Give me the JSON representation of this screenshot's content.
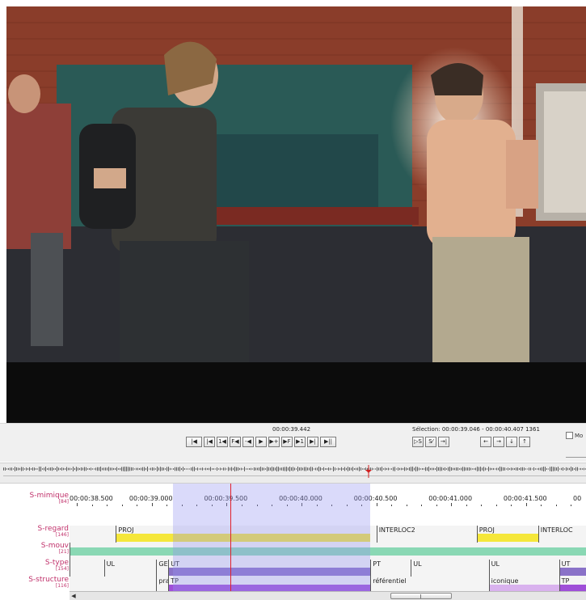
{
  "video": {
    "scene": "video-frame"
  },
  "transport": {
    "current_time": "00:00:39.442",
    "selection": "Sélection: 00:00:39.046 - 00:00:40.407  1361",
    "buttons": [
      {
        "label": "|◀",
        "name": "go-to-begin-button"
      },
      {
        "label": "|◀",
        "name": "previous-frame-button"
      },
      {
        "label": "1◀",
        "name": "step-back-1-button"
      },
      {
        "label": "F◀",
        "name": "fast-backward-button"
      },
      {
        "label": "-◀",
        "name": "step-back-ms-button"
      },
      {
        "label": "▶",
        "name": "play-button"
      },
      {
        "label": "▶+",
        "name": "step-forward-ms-button"
      },
      {
        "label": "▶F",
        "name": "fast-forward-button"
      },
      {
        "label": "▶1",
        "name": "step-forward-1-button"
      },
      {
        "label": "▶|",
        "name": "next-frame-button"
      },
      {
        "label": "▶||",
        "name": "go-to-end-button"
      }
    ],
    "selection_buttons": [
      {
        "label": "▷S",
        "name": "play-selection-button"
      },
      {
        "label": "S⁄",
        "name": "clear-selection-button"
      },
      {
        "label": "→|",
        "name": "selection-boundary-button"
      }
    ],
    "nav_buttons": [
      {
        "label": "←",
        "name": "navigate-left-button"
      },
      {
        "label": "→",
        "name": "navigate-right-button"
      },
      {
        "label": "↓",
        "name": "navigate-down-button"
      },
      {
        "label": "↑",
        "name": "navigate-up-button"
      }
    ],
    "checkbox_label": "Mo"
  },
  "ruler": {
    "labels": [
      "00:00:38.500",
      "00:00:39.000",
      "00:00:39.500",
      "00:00:40.000",
      "00:00:40.500",
      "00:00:41.000",
      "00:00:41.500",
      "00"
    ]
  },
  "tiers": [
    {
      "name": "S-mimique",
      "count": "[84]",
      "color": "#f4f4f4",
      "segments": []
    },
    {
      "name": "S-regard",
      "count": "[146]",
      "segments": [
        {
          "label": "PROJ",
          "start": 38.76,
          "end": 40.46,
          "color": "#f5e73a"
        },
        {
          "label": "INTERLOC2",
          "start": 40.5,
          "end": 41.17,
          "color": ""
        },
        {
          "label": "PROJ",
          "start": 41.17,
          "end": 41.58,
          "color": "#f5e73a"
        },
        {
          "label": "INTERLOC",
          "start": 41.58,
          "end": 41.9,
          "color": ""
        }
      ]
    },
    {
      "name": "S-mouv",
      "count": "[21]",
      "segments": [
        {
          "label": "",
          "start": 38.45,
          "end": 41.9,
          "color": "#8ad8b4"
        }
      ]
    },
    {
      "name": "S-type",
      "count": "[154]",
      "segments": [
        {
          "label": "",
          "start": 38.45,
          "end": 38.52,
          "color": ""
        },
        {
          "label": "UL",
          "start": 38.68,
          "end": 39.03,
          "color": ""
        },
        {
          "label": "GE",
          "start": 39.03,
          "end": 39.11,
          "color": ""
        },
        {
          "label": "UT",
          "start": 39.11,
          "end": 40.46,
          "color": "#8a72c8"
        },
        {
          "label": "PT",
          "start": 40.46,
          "end": 40.73,
          "color": ""
        },
        {
          "label": "UL",
          "start": 40.73,
          "end": 41.25,
          "color": ""
        },
        {
          "label": "UL",
          "start": 41.25,
          "end": 41.72,
          "color": ""
        },
        {
          "label": "UT",
          "start": 41.72,
          "end": 41.9,
          "color": "#8a72c8"
        }
      ]
    },
    {
      "name": "S-structure",
      "count": "[116]",
      "segments": [
        {
          "label": "pra",
          "start": 39.03,
          "end": 39.11,
          "color": ""
        },
        {
          "label": "TP",
          "start": 39.11,
          "end": 40.46,
          "color": "#9f4fd8"
        },
        {
          "label": "référentiel",
          "start": 40.46,
          "end": 40.73,
          "color": ""
        },
        {
          "label": "iconique",
          "start": 41.25,
          "end": 41.72,
          "color": "#d9b2ee"
        },
        {
          "label": "TP",
          "start": 41.72,
          "end": 41.9,
          "color": "#9f4fd8"
        }
      ]
    }
  ],
  "timeline_range": [
    38.45,
    41.9
  ],
  "colors": {
    "tier_name": "#c0306a",
    "selection": "#9696f0",
    "cursor": "#e0202a"
  }
}
